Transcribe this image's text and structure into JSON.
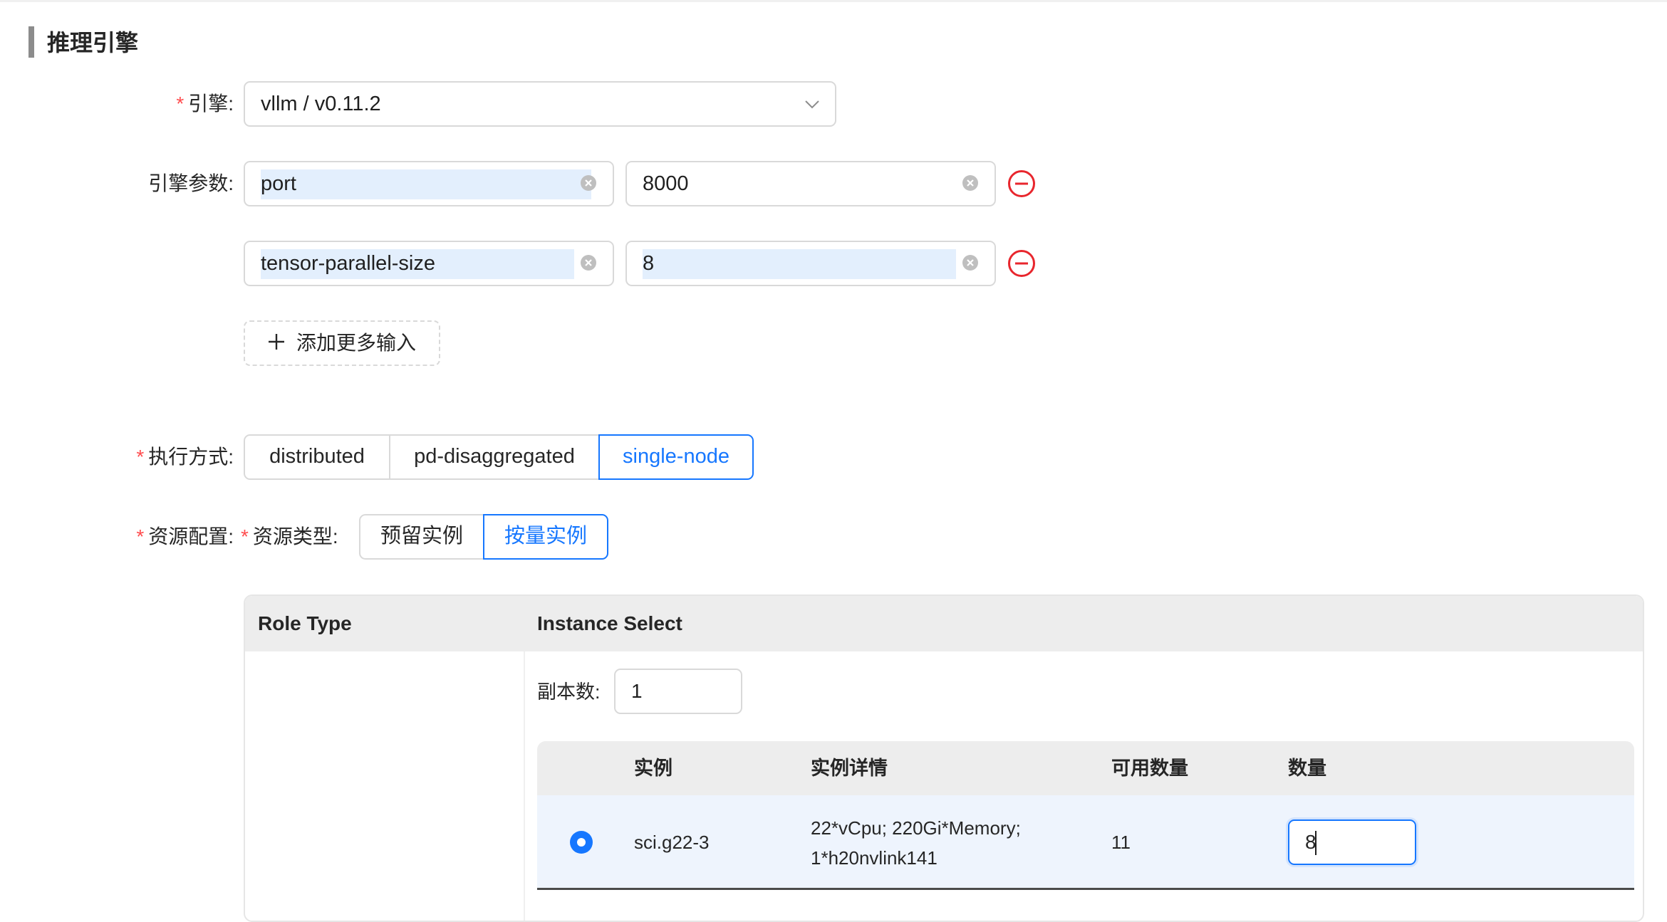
{
  "section": {
    "title": "推理引擎"
  },
  "engine": {
    "required_mark": "*",
    "label": "引擎:",
    "value": "vllm / v0.11.2",
    "arrow_icon": "chevron-down-icon"
  },
  "engine_params": {
    "label": "引擎参数:",
    "rows": [
      {
        "key": "port",
        "value": "8000"
      },
      {
        "key": "tensor-parallel-size",
        "value": "8"
      }
    ],
    "clear_icon": "clear-circle-icon",
    "remove_icon": "minus-circle-icon",
    "add_label": "添加更多输入",
    "add_icon": "plus-icon"
  },
  "exec_mode": {
    "required_mark": "*",
    "label": "执行方式:",
    "options": [
      "distributed",
      "pd-disaggregated",
      "single-node"
    ],
    "selected": "single-node"
  },
  "resource": {
    "required_mark": "*",
    "label": "资源配置:",
    "type_required_mark": "*",
    "type_label": "资源类型:",
    "type_options": [
      "预留实例",
      "按量实例"
    ],
    "type_selected": "按量实例"
  },
  "table": {
    "headers": {
      "role_type": "Role Type",
      "instance_select": "Instance Select"
    },
    "replicas_label": "副本数:",
    "replicas_value": "1",
    "instance_headers": {
      "instance": "实例",
      "details": "实例详情",
      "available": "可用数量",
      "quantity": "数量"
    },
    "rows": [
      {
        "instance": "sci.g22-3",
        "details_line1": "22*vCpu; 220Gi*Memory;",
        "details_line2": "1*h20nvlink141",
        "available": "11",
        "quantity": "8",
        "selected": true
      }
    ]
  },
  "colors": {
    "accent": "#1677ff",
    "danger": "#ff4d4f",
    "remove": "#e8262d",
    "highlight": "#e3effd"
  }
}
